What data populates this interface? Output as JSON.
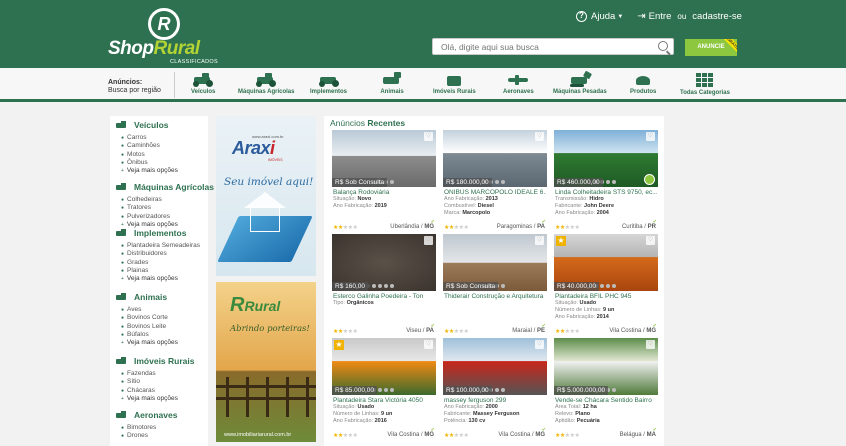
{
  "header": {
    "logo_text_shop": "Shop",
    "logo_text_rural": "Rural",
    "logo_subtitle": "CLASSIFICADOS",
    "logo_letter": "R",
    "help_label": "Ajuda",
    "login_label": "Entre",
    "or_label": "ou",
    "register_label": "cadastre-se",
    "search_placeholder": "Olá, digite aqui sua busca",
    "anuncie_label": "ANUNCIE",
    "anuncie_ribbon": "GRÁTIS",
    "brand_color": "#2e7150",
    "accent_color": "#8dc63f"
  },
  "catbar": {
    "label_title": "Anúncios:",
    "label_sub": "Busca por região",
    "items": [
      {
        "label": "Veículos",
        "icon": "truck-icon"
      },
      {
        "label": "Máquinas Agrícolas",
        "icon": "tractor-icon"
      },
      {
        "label": "Implementos",
        "icon": "implement-icon"
      },
      {
        "label": "Animais",
        "icon": "horse-icon"
      },
      {
        "label": "Imóveis Rurais",
        "icon": "farmhouse-icon"
      },
      {
        "label": "Aeronaves",
        "icon": "airplane-icon"
      },
      {
        "label": "Máquinas Pesadas",
        "icon": "excavator-icon"
      },
      {
        "label": "Produtos",
        "icon": "product-icon"
      },
      {
        "label": "Todas Categorias",
        "icon": "grid-icon"
      }
    ]
  },
  "sidebar": {
    "cats": [
      {
        "title": "Veículos",
        "subs": [
          "Carros",
          "Caminhões",
          "Motos",
          "Ônibus"
        ],
        "more": "Veja mais opções"
      },
      {
        "title": "Máquinas Agrícolas",
        "subs": [
          "Colhedeiras",
          "Tratores",
          "Pulverizadores"
        ],
        "more": "Veja mais opções"
      },
      {
        "title": "Implementos",
        "subs": [
          "Plantadeira Semeadeiras",
          "Distribuidores",
          "Grades",
          "Plainas"
        ],
        "more": "Veja mais opções"
      },
      {
        "title": "Animais",
        "subs": [
          "Aves",
          "Bovinos Corte",
          "Bovinos Leite",
          "Búfalos"
        ],
        "more": "Veja mais opções"
      },
      {
        "title": "Imóveis Rurais",
        "subs": [
          "Fazendas",
          "Sítio",
          "Chácaras"
        ],
        "more": "Veja mais opções"
      },
      {
        "title": "Aeronaves",
        "subs": [
          "Bimotores",
          "Drones"
        ],
        "more": ""
      }
    ]
  },
  "banners": {
    "b1_url": "www.araxi.com.br",
    "b1_brand": "Arax",
    "b1_brand_end": "i",
    "b1_tag": "IMÓVEIS",
    "b1_slogan": "Seu imóvel aqui!",
    "b2_logo": "R",
    "b2_logo_rest": "Rural",
    "b2_slogan": "Abrindo porteiras!",
    "b2_site": "www.imobiliariarural.com.br"
  },
  "main": {
    "title_a": "Anúncios",
    "title_b": "Recentes",
    "cards": [
      {
        "price": "R$ Sob Consulta",
        "title": "Balança Rodoviária",
        "specs": [
          [
            "Situação:",
            "Novo"
          ],
          [
            "Ano Fabricação:",
            "2019"
          ]
        ],
        "loc_a": "Uberlândia",
        "loc_b": "MG",
        "featured": false
      },
      {
        "price": "R$ 180.000,00",
        "title": "ÔNIBUS MARCOPOLO IDEALE 6...",
        "specs": [
          [
            "Ano Fabricação:",
            "2013"
          ],
          [
            "Combustível:",
            "Diesel"
          ],
          [
            "Marca:",
            "Marcopolo"
          ]
        ],
        "loc_a": "Paragominas",
        "loc_b": "PA",
        "featured": false
      },
      {
        "price": "R$ 460.000,00",
        "title": "Linda Colheitadeira STS 9750, ec...",
        "specs": [
          [
            "Transmissão:",
            "Hidro"
          ],
          [
            "Fabricante:",
            "John Deere"
          ],
          [
            "Ano Fabricação:",
            "2004"
          ]
        ],
        "loc_a": "Curitiba",
        "loc_b": "PR",
        "featured": false
      },
      {
        "price": "R$ 160,00",
        "title": "Esterco Galinha Poedeira - Ton",
        "specs": [
          [
            "Tipo:",
            "Orgânicos"
          ]
        ],
        "loc_a": "Viseu",
        "loc_b": "PA",
        "featured": false
      },
      {
        "price": "R$ Sob Consulta",
        "title": "Thiderair Construção e Arquitetura",
        "specs": [],
        "loc_a": "Maraial",
        "loc_b": "PE",
        "featured": false
      },
      {
        "price": "R$ 40.000,00",
        "title": "Plantadeira BFIL PHC 945",
        "specs": [
          [
            "Situação:",
            "Usado"
          ],
          [
            "Número de Linhas:",
            "9 un"
          ],
          [
            "Ano Fabricação:",
            "2014"
          ]
        ],
        "loc_a": "Vila Costina",
        "loc_b": "MG",
        "featured": true
      },
      {
        "price": "R$ 85.000,00",
        "title": "Plantadeira Stara Victória 4050",
        "specs": [
          [
            "Situação:",
            "Usado"
          ],
          [
            "Número de Linhas:",
            "9 un"
          ],
          [
            "Ano Fabricação:",
            "2016"
          ]
        ],
        "loc_a": "Vila Costina",
        "loc_b": "MG",
        "featured": true
      },
      {
        "price": "R$ 100.000,00",
        "title": "massey ferguson 299",
        "specs": [
          [
            "Ano Fabricação:",
            "2000"
          ],
          [
            "Fabricante:",
            "Massey Ferguson"
          ],
          [
            "Potência:",
            "130 cv"
          ]
        ],
        "loc_a": "Vila Costina",
        "loc_b": "MG",
        "featured": false
      },
      {
        "price": "R$ 5.000.000,00",
        "title": "Vende-se Chácara Sentido Bairro",
        "specs": [
          [
            "Área Total:",
            "12 ha"
          ],
          [
            "Relevo:",
            "Plano"
          ],
          [
            "Aptidão:",
            "Pecuária"
          ]
        ],
        "loc_a": "Belágua",
        "loc_b": "MA",
        "featured": false
      }
    ]
  }
}
